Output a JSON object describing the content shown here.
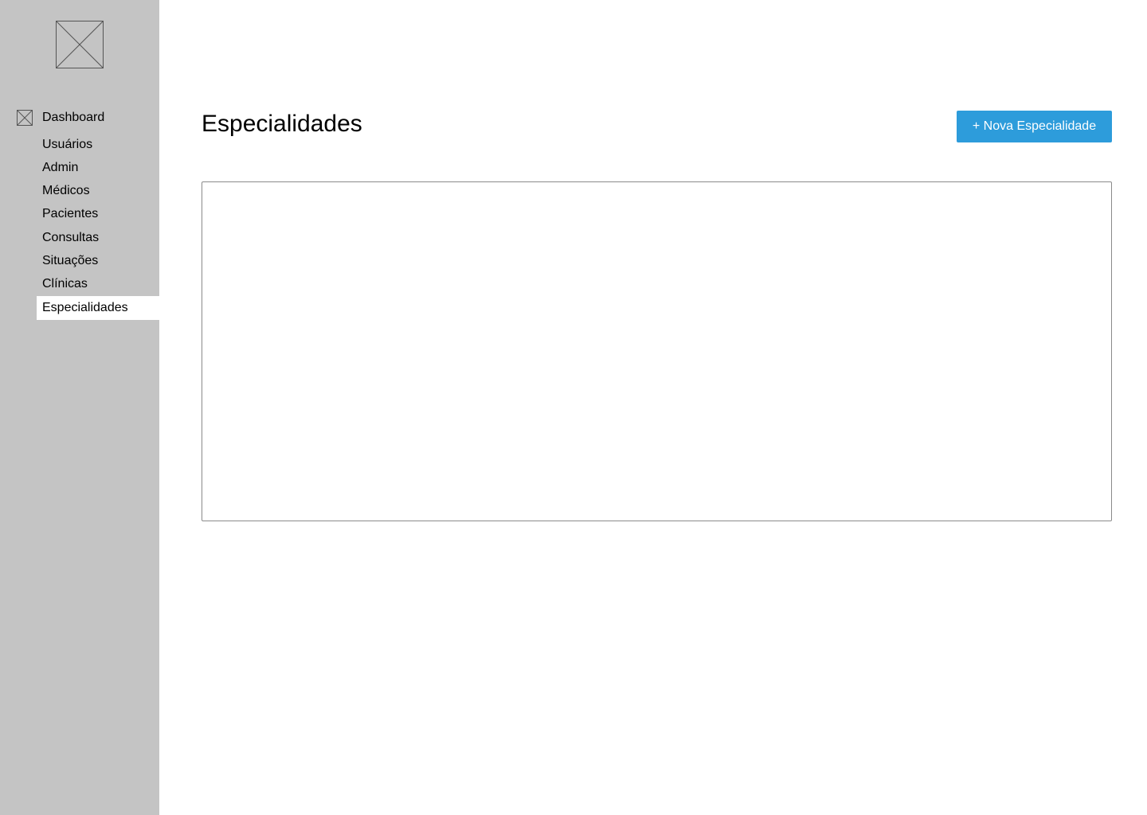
{
  "sidebar": {
    "logo_icon": "image-placeholder-icon",
    "dashboard_icon": "image-placeholder-icon",
    "items": [
      {
        "label": "Dashboard",
        "active": false
      },
      {
        "label": "Usuários",
        "active": false
      },
      {
        "label": "Admin",
        "active": false
      },
      {
        "label": "Médicos",
        "active": false
      },
      {
        "label": "Pacientes",
        "active": false
      },
      {
        "label": "Consultas",
        "active": false
      },
      {
        "label": "Situações",
        "active": false
      },
      {
        "label": "Clínicas",
        "active": false
      },
      {
        "label": "Especialidades",
        "active": true
      }
    ]
  },
  "header": {
    "title": "Especialidades",
    "new_button_label": "+ Nova Especialidade"
  },
  "colors": {
    "sidebar_bg": "#c4c4c4",
    "accent": "#2d9cdb",
    "active_item_bg": "#ffffff",
    "panel_border": "#8a8a8a"
  }
}
